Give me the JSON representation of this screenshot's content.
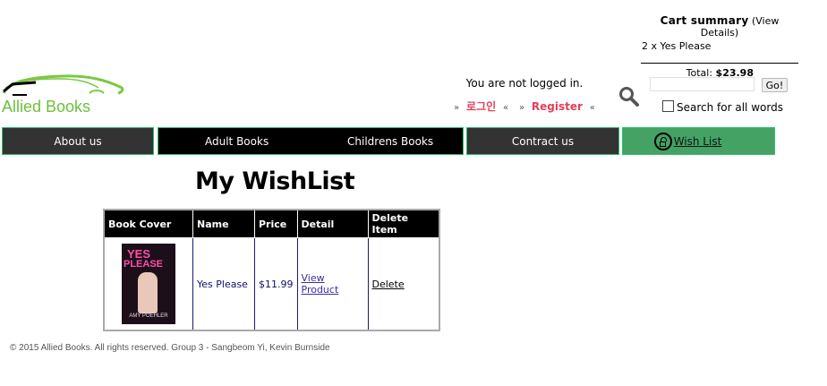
{
  "cart": {
    "title": "Cart summary",
    "view_details": "(View Details)",
    "item_line": "2 x Yes Please",
    "total_label": "Total:",
    "total_value": "$23.98"
  },
  "logo": {
    "text": "Allied Books"
  },
  "login": {
    "status": "You are not logged in.",
    "korean_login": "로그인",
    "register": "Register"
  },
  "search": {
    "button": "Go!",
    "all_words": "Search for all words",
    "value": ""
  },
  "nav": {
    "about": "About us",
    "adult": "Adult Books",
    "children": "Childrens Books",
    "contract": "Contract us",
    "wishlist": "Wish List"
  },
  "page": {
    "title": "My WishList"
  },
  "table": {
    "headers": [
      "Book Cover",
      "Name",
      "Price",
      "Detail",
      "Delete Item"
    ],
    "rows": [
      {
        "cover_title_1": "YES",
        "cover_title_2": "PLEASE",
        "cover_author": "AMY POEHLER",
        "name": "Yes Please",
        "price": "$11.99",
        "detail": "View Product",
        "delete": "Delete"
      }
    ]
  },
  "footer": {
    "text": "© 2015 Allied Books. All rights reserved. Group 3 - Sangbeom Yi, Kevin Burnside"
  },
  "colors": {
    "nav_border": "#2bbf6b",
    "wishlist_bg": "#44a265",
    "logo_green": "#6cc03b",
    "login_link": "#e23f5a"
  }
}
